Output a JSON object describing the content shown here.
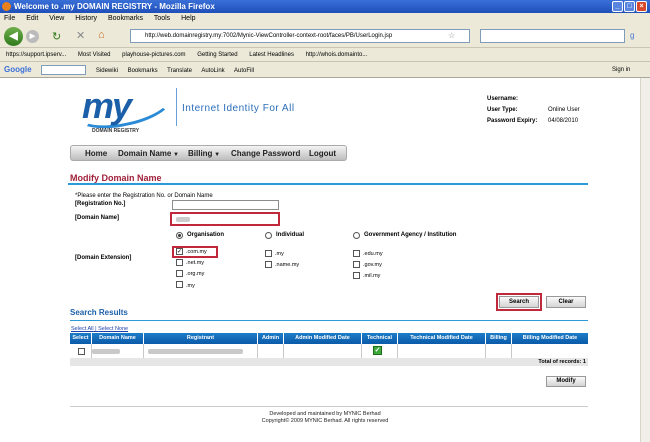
{
  "window": {
    "title": "Welcome to .my DOMAIN REGISTRY - Mozilla Firefox"
  },
  "menu": [
    "File",
    "Edit",
    "View",
    "History",
    "Bookmarks",
    "Tools",
    "Help"
  ],
  "browser": {
    "url": "http://web.domainregistry.my:7002/Mynic-ViewController-context-root/faces/PB/UserLogin.jsp",
    "bookmarks": [
      "https://support.ipserv...",
      "Most Visited",
      "playhouse-pictures.com",
      "Getting Started",
      "Latest Headlines",
      "http://whois.domainto..."
    ],
    "google_toolbar": [
      "Sidewiki",
      "Bookmarks",
      "Translate",
      "AutoLink",
      "AutoFill",
      "Sign in"
    ],
    "google_label": "Google"
  },
  "site": {
    "logo_text": "my",
    "logo_sub": "DOMAIN REGISTRY",
    "tagline": "Internet Identity For All",
    "user_info": [
      {
        "label": "Username:",
        "value": ""
      },
      {
        "label": "User Type:",
        "value": "Online User"
      },
      {
        "label": "Password Expiry:",
        "value": "04/08/2010"
      }
    ],
    "nav": [
      "Home",
      "Domain Name",
      "Billing",
      "Change Password",
      "Logout"
    ]
  },
  "form": {
    "heading": "Modify Domain Name",
    "instruction": "*Please enter the Registration No. or Domain Name",
    "reg_label": "[Registration No.]",
    "domain_label": "[Domain Name]",
    "ext_label": "[Domain Extension]",
    "radios": [
      {
        "label": "Organisation",
        "selected": true
      },
      {
        "label": "Individual",
        "selected": false
      },
      {
        "label": "Government Agency / Institution",
        "selected": false
      }
    ],
    "extensions_org": [
      ".com.my",
      ".net.my",
      ".org.my",
      ".my"
    ],
    "extensions_ind": [
      ".my",
      ".name.my"
    ],
    "extensions_gov": [
      ".edu.my",
      ".gov.my",
      ".mil.my"
    ],
    "search_btn": "Search",
    "clear_btn": "Clear"
  },
  "results": {
    "title": "Search Results",
    "select_all": "Select All",
    "select_none": "Select None",
    "separator": "|",
    "columns": [
      "Select",
      "Domain Name",
      "Registrant",
      "Admin",
      "Admin Modified Date",
      "Technical",
      "Technical Modified Date",
      "Billing",
      "Billing Modified Date"
    ],
    "total": "Total of records: 1",
    "modify_btn": "Modify"
  },
  "footer": {
    "line1": "Developed and maintained by MYNIC Berhad",
    "line2": "Copyright© 2009 MYNIC Berhad. All rights reserved"
  },
  "colors": {
    "accent": "#1b5fa8",
    "heading": "#a0213a",
    "highlight": "#c0283c",
    "table_header": "#0a5aa8"
  }
}
